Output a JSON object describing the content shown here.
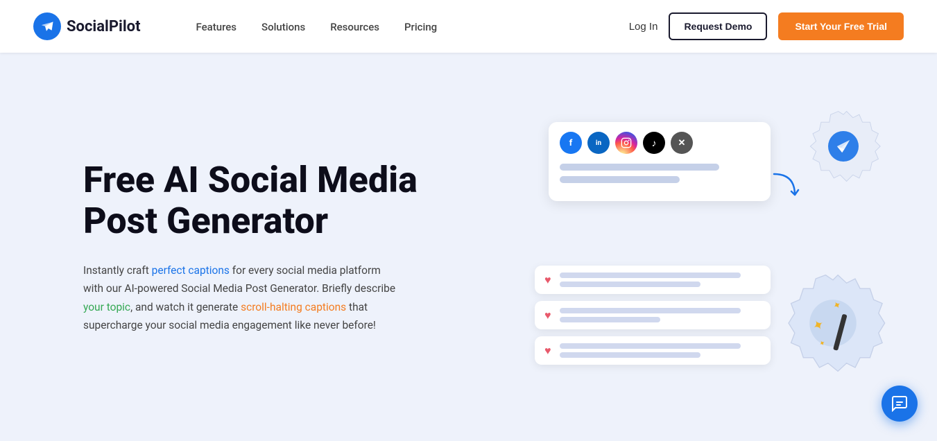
{
  "brand": {
    "name": "SocialPilot",
    "logo_alt": "SocialPilot logo"
  },
  "nav": {
    "items": [
      {
        "id": "features",
        "label": "Features"
      },
      {
        "id": "solutions",
        "label": "Solutions"
      },
      {
        "id": "resources",
        "label": "Resources"
      },
      {
        "id": "pricing",
        "label": "Pricing"
      }
    ],
    "login_label": "Log In",
    "demo_label": "Request Demo",
    "trial_label": "Start Your Free Trial"
  },
  "hero": {
    "title": "Free AI Social Media Post Generator",
    "description_parts": {
      "before": "Instantly craft ",
      "highlight1": "perfect captions",
      "mid1": " for every social media platform with our AI-powered Social Media Post Generator. Briefly describe ",
      "highlight2": "your topic",
      "mid2": ", and watch it generate ",
      "highlight3": "scroll-halting captions",
      "end": " that supercharge your social media engagement like never before!"
    }
  },
  "social_icons": [
    {
      "id": "facebook",
      "letter": "f",
      "color_class": "s-fb"
    },
    {
      "id": "linkedin",
      "letter": "in",
      "color_class": "s-li"
    },
    {
      "id": "instagram",
      "letter": "📷",
      "color_class": "s-ig"
    },
    {
      "id": "tiktok",
      "letter": "♪",
      "color_class": "s-tk"
    },
    {
      "id": "twitter",
      "letter": "✕",
      "color_class": "s-tw"
    }
  ],
  "chat": {
    "icon_label": "chat-bubble"
  }
}
